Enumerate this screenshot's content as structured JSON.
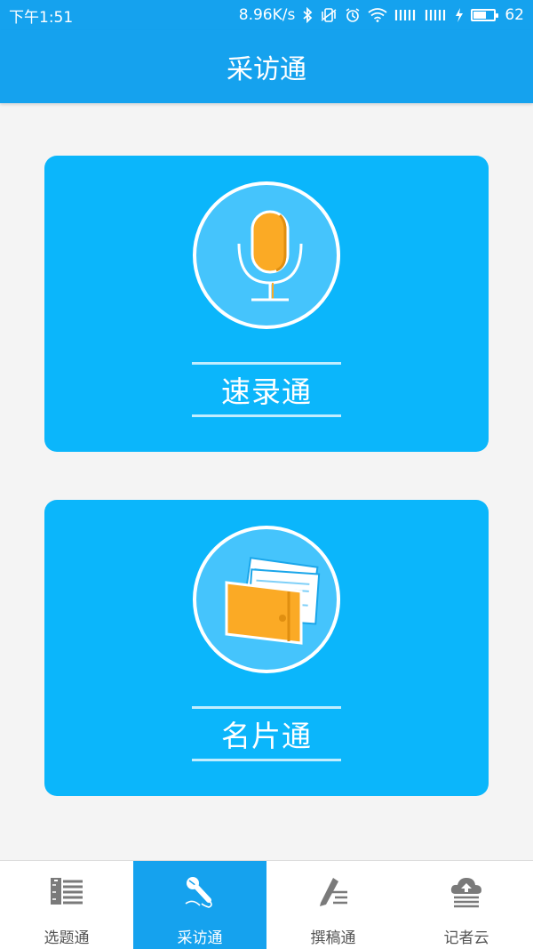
{
  "status_bar": {
    "time": "下午1:51",
    "net_speed": "8.96K/s",
    "battery": "62",
    "battery_level": 0.62
  },
  "header": {
    "title": "采访通"
  },
  "cards": [
    {
      "label": "速录通",
      "icon": "microphone-icon"
    },
    {
      "label": "名片通",
      "icon": "business-card-icon"
    }
  ],
  "tabs": [
    {
      "label": "选题通",
      "icon": "topic-list-icon",
      "active": false
    },
    {
      "label": "采访通",
      "icon": "microphone-icon",
      "active": true
    },
    {
      "label": "撰稿通",
      "icon": "pen-write-icon",
      "active": false
    },
    {
      "label": "记者云",
      "icon": "cloud-upload-icon",
      "active": false
    }
  ],
  "colors": {
    "brand_blue": "#15a2ee",
    "card_blue": "#0bb6fb",
    "accent_orange": "#fbaa25",
    "background": "#f4f4f4"
  }
}
